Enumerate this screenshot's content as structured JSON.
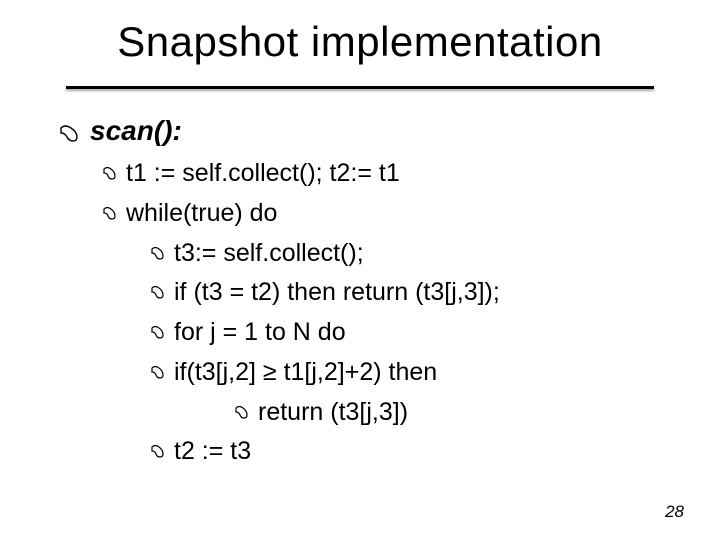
{
  "title": "Snapshot implementation",
  "page_number": "28",
  "content": {
    "heading": "scan():",
    "line1": "t1 := self.collect(); t2:= t1",
    "line2": "while(true) do",
    "line3": "t3:= self.collect();",
    "line4": "if (t3 = t2) then return (t3[j,3]);",
    "line5": "for j = 1 to N do",
    "line6": "if(t3[j,2] ≥ t1[j,2]+2) then",
    "line7": "return (t3[j,3])",
    "line8": "t2 := t3"
  }
}
